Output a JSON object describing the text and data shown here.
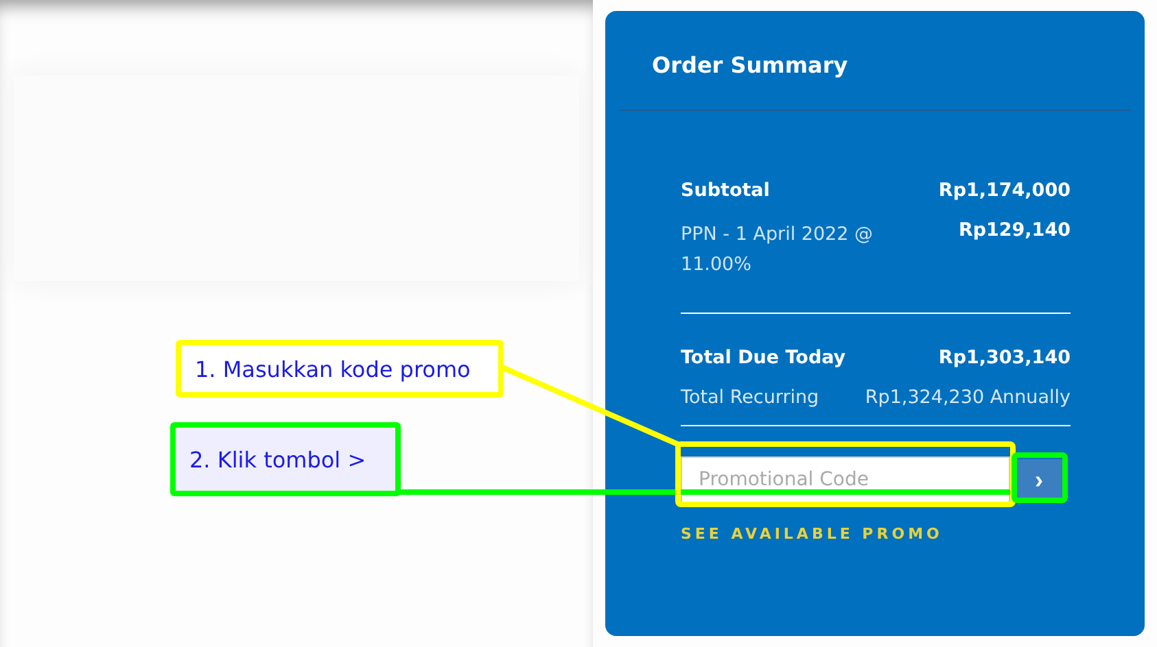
{
  "order_summary": {
    "title": "Order Summary",
    "lines": [
      {
        "kind": "strong",
        "label": "Subtotal",
        "amount": "Rp1,174,000"
      },
      {
        "kind": "tax",
        "label": "PPN - 1 April 2022 @ 11.00%",
        "amount": "Rp129,140"
      },
      {
        "kind": "divider"
      },
      {
        "kind": "strong",
        "label": "Total Due Today",
        "amount": "Rp1,303,140"
      },
      {
        "kind": "light",
        "label": "Total Recurring",
        "amount": "Rp1,324,230 Annually"
      },
      {
        "kind": "divider"
      }
    ],
    "promo": {
      "placeholder": "Promotional Code",
      "button": "›",
      "link": "SEE AVAILABLE PROMO"
    }
  },
  "annotations": [
    {
      "text": "1. Masukkan kode promo",
      "color": "#ffff00"
    },
    {
      "text": "2. Klik tombol  >",
      "color": "#00ff00"
    }
  ]
}
